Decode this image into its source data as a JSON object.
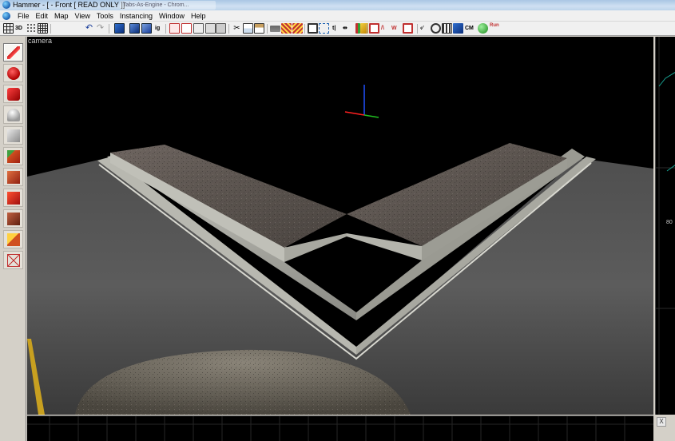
{
  "window": {
    "title": "Hammer - [ - Front [ READ ONLY ]]",
    "background_tab_title": "Tabs-As-Engine - Chrom..."
  },
  "menu": {
    "items": [
      "File",
      "Edit",
      "Map",
      "View",
      "Tools",
      "Instancing",
      "Window",
      "Help"
    ]
  },
  "toolbar": {
    "buttons": [
      "grid-icon",
      "3d-grid-icon",
      "grid-dots-icon",
      "grid-large-icon",
      "undo-icon",
      "redo-icon",
      "carve-icon",
      "group-icon",
      "ungroup-icon",
      "ignore-groups-icon",
      "hide-selected-icon",
      "show-all-icon",
      "hide-unselected-icon",
      "show-all-hidden-icon",
      "cut-icon",
      "copy-icon",
      "paste-icon",
      "texture-lock-icon",
      "texture-scale-lock-icon",
      "select-all-icon",
      "select-icon",
      "flip-horizontal-icon",
      "flip-vertical-icon",
      "entity-report-icon",
      "compile-icon",
      "map-props-icon",
      "wireframe-icon",
      "normals-icon",
      "decals-icon",
      "model-icon",
      "cubemap-icon",
      "cordon-icon",
      "leak-icon"
    ],
    "cm_label": "CM",
    "run_label": "Run"
  },
  "tools": {
    "items": [
      "selection-tool-icon",
      "magnify-tool-icon",
      "camera-tool-icon",
      "entity-tool-icon",
      "block-tool-icon",
      "texture-application-icon",
      "apply-texture-icon",
      "decal-tool-icon",
      "overlay-tool-icon",
      "clipping-tool-icon",
      "vertex-tool-icon"
    ],
    "active_index": 0
  },
  "viewports": {
    "camera_label": "camera",
    "right_view_coordinate": "80",
    "corner_button": "X"
  }
}
